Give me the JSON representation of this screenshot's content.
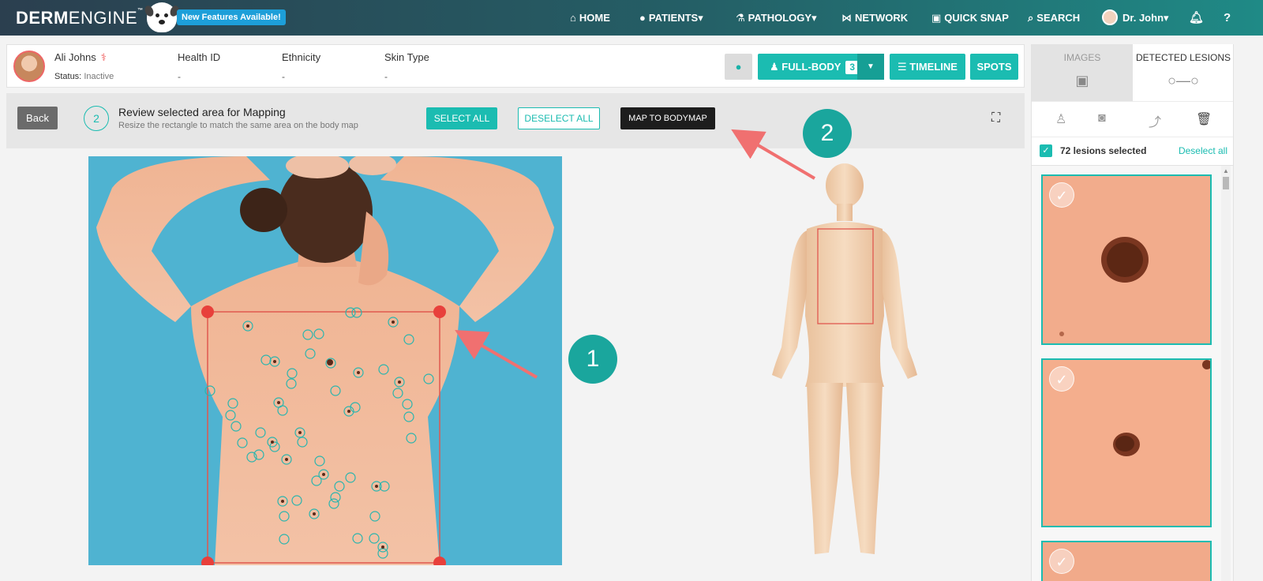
{
  "nav": {
    "logo_bold": "DERM",
    "logo_light": "ENGINE",
    "logo_tm": "™",
    "new_features": "New Features Available!",
    "items": [
      {
        "label": "HOME",
        "icon": "home-icon"
      },
      {
        "label": "PATIENTS",
        "icon": "users-icon"
      },
      {
        "label": "PATHOLOGY",
        "icon": "microscope-icon"
      },
      {
        "label": "NETWORK",
        "icon": "network-icon"
      },
      {
        "label": "QUICK SNAP",
        "icon": "camera-icon"
      },
      {
        "label": "SEARCH",
        "icon": "search-icon"
      }
    ],
    "user": "Dr. John",
    "caret": "▾"
  },
  "patient": {
    "name": "Ali Johns",
    "status_label": "Status:",
    "status_value": "Inactive",
    "fields": [
      {
        "label": "Health ID",
        "value": "-"
      },
      {
        "label": "Ethnicity",
        "value": "-"
      },
      {
        "label": "Skin Type",
        "value": "-"
      }
    ]
  },
  "toolbar": {
    "fullbody_label": "FULL-BODY",
    "fullbody_count": "3",
    "timeline_label": "TIMELINE",
    "spots_label": "SPOTS"
  },
  "step": {
    "back_label": "Back",
    "number": "2",
    "title": "Review selected area for Mapping",
    "subtitle": "Resize the rectangle to match the same area on the body map",
    "select_all": "SELECT ALL",
    "deselect_all": "DESELECT ALL",
    "map_to_bodymap": "MAP TO BODYMAP"
  },
  "annotations": {
    "one": "1",
    "two": "2"
  },
  "right_panel": {
    "tab_images": "IMAGES",
    "tab_detected": "DETECTED LESIONS",
    "selected_text": "72 lesions selected",
    "deselect_link": "Deselect all"
  },
  "colors": {
    "teal": "#1bbcb1",
    "nav_dark": "#2b3f4f",
    "annotation_red": "#f07070"
  }
}
